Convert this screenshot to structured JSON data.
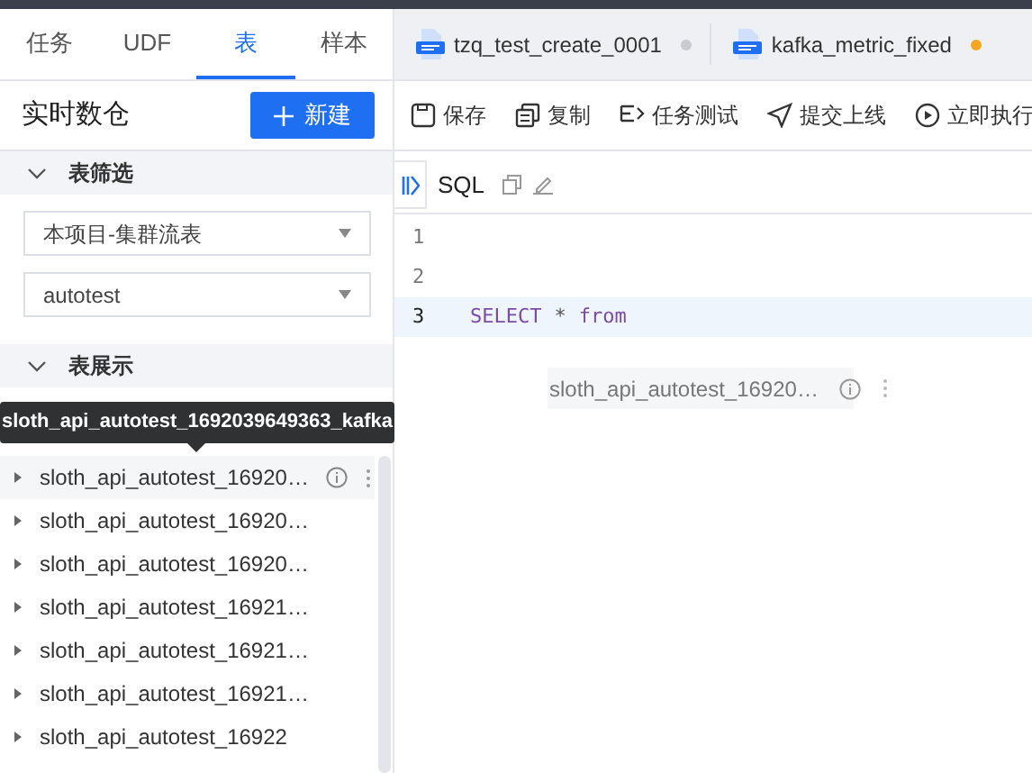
{
  "left_tabs": [
    {
      "label": "任务",
      "selected": false
    },
    {
      "label": "UDF",
      "selected": false
    },
    {
      "label": "表",
      "selected": true
    },
    {
      "label": "样本",
      "selected": false
    }
  ],
  "panel": {
    "title": "实时数仓",
    "new_button": "新建"
  },
  "filter_section": {
    "title": "表筛选",
    "expanded": true,
    "selects": [
      {
        "value": "本项目-集群流表"
      },
      {
        "value": "autotest"
      }
    ]
  },
  "display_section": {
    "title": "表展示",
    "expanded": true
  },
  "tooltip": "sloth_api_autotest_1692039649363_kafka",
  "tables": [
    {
      "name": "sloth_api_autotest_16920…",
      "hovered": true
    },
    {
      "name": "sloth_api_autotest_16920…",
      "hovered": false
    },
    {
      "name": "sloth_api_autotest_16920…",
      "hovered": false
    },
    {
      "name": "sloth_api_autotest_16921…",
      "hovered": false
    },
    {
      "name": "sloth_api_autotest_16921…",
      "hovered": false
    },
    {
      "name": "sloth_api_autotest_16921…",
      "hovered": false
    },
    {
      "name": "sloth_api_autotest_16922",
      "hovered": false
    }
  ],
  "editor_tabs": [
    {
      "title": "tzq_test_create_0001",
      "modified": false
    },
    {
      "title": "kafka_metric_fixed",
      "modified": true
    }
  ],
  "toolbar": [
    {
      "label": "保存",
      "kind": "save"
    },
    {
      "label": "复制",
      "kind": "copy"
    },
    {
      "label": "任务测试",
      "kind": "test"
    },
    {
      "label": "提交上线",
      "kind": "submit"
    },
    {
      "label": "立即执行",
      "kind": "run"
    }
  ],
  "sql_bar": {
    "title": "SQL"
  },
  "code_lines": [
    {
      "number": "1",
      "active": false
    },
    {
      "number": "2",
      "active": false
    },
    {
      "number": "3",
      "active": true,
      "tokens": [
        {
          "text": "SELECT",
          "kind": "keyword"
        },
        {
          "text": "*",
          "kind": "operator"
        },
        {
          "text": "from",
          "kind": "keyword"
        }
      ]
    }
  ],
  "drag_preview": {
    "name": "sloth_api_autotest_16920…"
  }
}
